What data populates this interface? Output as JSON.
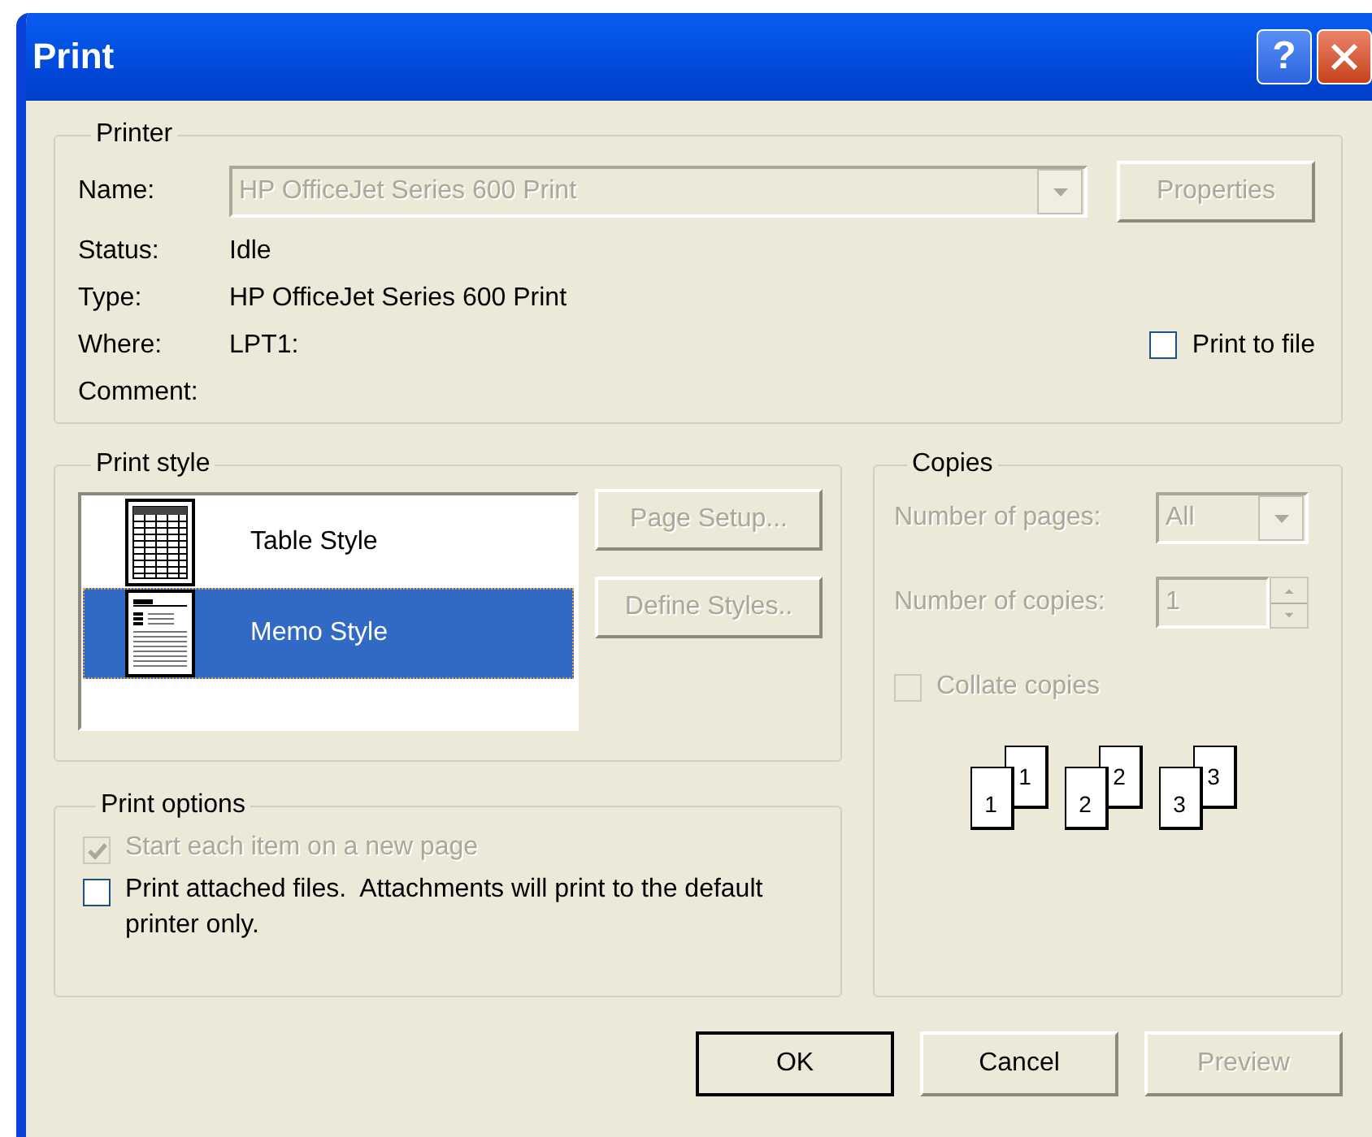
{
  "window": {
    "title": "Print",
    "help_button": {
      "label": "?"
    }
  },
  "printer": {
    "label": "Printer",
    "name": {
      "label": "Name:",
      "value": "HP OfficeJet Series 600 Print",
      "disabled": true
    },
    "properties_button": {
      "label": "Properties",
      "disabled": true
    },
    "fields": [
      {
        "label": "Status:",
        "value": "Idle"
      },
      {
        "label": "Type:",
        "value": "HP OfficeJet Series 600 Print"
      },
      {
        "label": "Where:",
        "value": "LPT1:"
      },
      {
        "label": "Comment:"
      }
    ],
    "print_to_file": {
      "label": "Print to file",
      "checked": false
    }
  },
  "print_style": {
    "label": "Print style",
    "styles": [
      {
        "label": "Table Style",
        "kind": "table",
        "selected": false
      },
      {
        "label": "Memo Style",
        "kind": "memo",
        "selected": true
      }
    ],
    "buttons": [
      {
        "label": "Page Setup...",
        "disabled": true
      },
      {
        "label": "Define Styles..",
        "disabled": true
      }
    ]
  },
  "print_options": {
    "label": "Print options",
    "options": [
      {
        "label": "Start each item on a new page",
        "checked": true,
        "disabled": true
      },
      {
        "label": "Print attached files.  Attachments will print to the default printer only.",
        "checked": false,
        "disabled": false
      }
    ]
  },
  "copies": {
    "label": "Copies",
    "number_of_pages": {
      "label": "Number of pages:",
      "value": "All",
      "disabled": true
    },
    "number_of_copies": {
      "label": "Number of copies:",
      "value": "1",
      "disabled": true
    },
    "collate": {
      "label": "Collate copies",
      "checked": false,
      "disabled": true
    },
    "collate_sets": [
      {
        "front": "1",
        "back": "1"
      },
      {
        "front": "2",
        "back": "2"
      },
      {
        "front": "3",
        "back": "3"
      }
    ]
  },
  "buttons": [
    {
      "label": "OK",
      "default": true,
      "disabled": false
    },
    {
      "label": "Cancel",
      "default": false,
      "disabled": false
    },
    {
      "label": "Preview",
      "default": false,
      "disabled": true
    }
  ]
}
